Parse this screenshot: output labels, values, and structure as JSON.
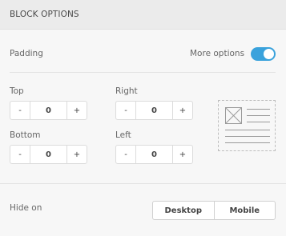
{
  "header": {
    "title": "BLOCK OPTIONS"
  },
  "padding": {
    "label": "Padding",
    "more_options_label": "More options",
    "more_options_enabled": true,
    "top": {
      "label": "Top",
      "minus": "-",
      "value": "0",
      "plus": "+"
    },
    "right": {
      "label": "Right",
      "minus": "-",
      "value": "0",
      "plus": "+"
    },
    "bottom": {
      "label": "Bottom",
      "minus": "-",
      "value": "0",
      "plus": "+"
    },
    "left": {
      "label": "Left",
      "minus": "-",
      "value": "0",
      "plus": "+"
    },
    "preview_icon": "block-layout-preview-icon"
  },
  "hide_on": {
    "label": "Hide on",
    "options": [
      "Desktop",
      "Mobile"
    ]
  },
  "colors": {
    "accent": "#3aa2dc",
    "header_bg": "#ebebeb",
    "panel_bg": "#f7f7f7"
  }
}
